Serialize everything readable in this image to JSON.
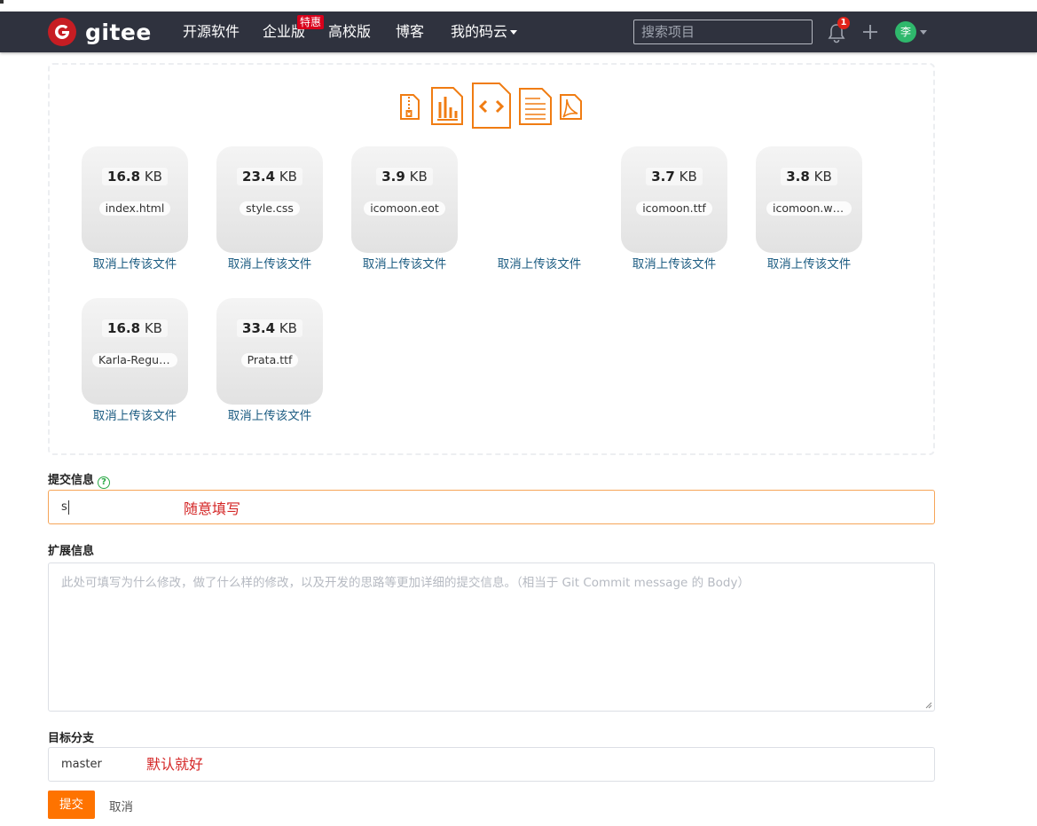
{
  "navbar": {
    "brand": "gitee",
    "items": [
      {
        "label": "开源软件"
      },
      {
        "label": "企业版",
        "badge": "特惠"
      },
      {
        "label": "高校版"
      },
      {
        "label": "博客"
      },
      {
        "label": "我的码云"
      }
    ],
    "search_placeholder": "搜索项目",
    "notification_count": "1",
    "avatar_initial": "李"
  },
  "uploader": {
    "type_icons": [
      "zip-file-icon",
      "chart-file-icon",
      "code-file-icon",
      "text-file-icon",
      "pdf-file-icon"
    ],
    "accent_color": "#f07c12",
    "cancel_label": "取消上传该文件",
    "files": [
      {
        "size": "16.8",
        "unit": "KB",
        "name": "index.html"
      },
      {
        "size": "23.4",
        "unit": "KB",
        "name": "style.css"
      },
      {
        "size": "3.9",
        "unit": "KB",
        "name": "icomoon.eot"
      },
      {
        "size": "",
        "unit": "",
        "name": ""
      },
      {
        "size": "3.7",
        "unit": "KB",
        "name": "icomoon.ttf"
      },
      {
        "size": "3.8",
        "unit": "KB",
        "name": "icomoon.woff"
      },
      {
        "size": "16.8",
        "unit": "KB",
        "name": "Karla-Regular..."
      },
      {
        "size": "33.4",
        "unit": "KB",
        "name": "Prata.ttf"
      }
    ]
  },
  "form": {
    "commit_label": "提交信息",
    "commit_value": "s",
    "commit_annotation": "随意填写",
    "ext_label": "扩展信息",
    "ext_placeholder": "此处可填写为什么修改，做了什么样的修改，以及开发的思路等更加详细的提交信息。（相当于 Git Commit message 的 Body）",
    "branch_label": "目标分支",
    "branch_value": "master",
    "branch_annotation": "默认就好",
    "submit_label": "提交",
    "cancel_label": "取消"
  }
}
